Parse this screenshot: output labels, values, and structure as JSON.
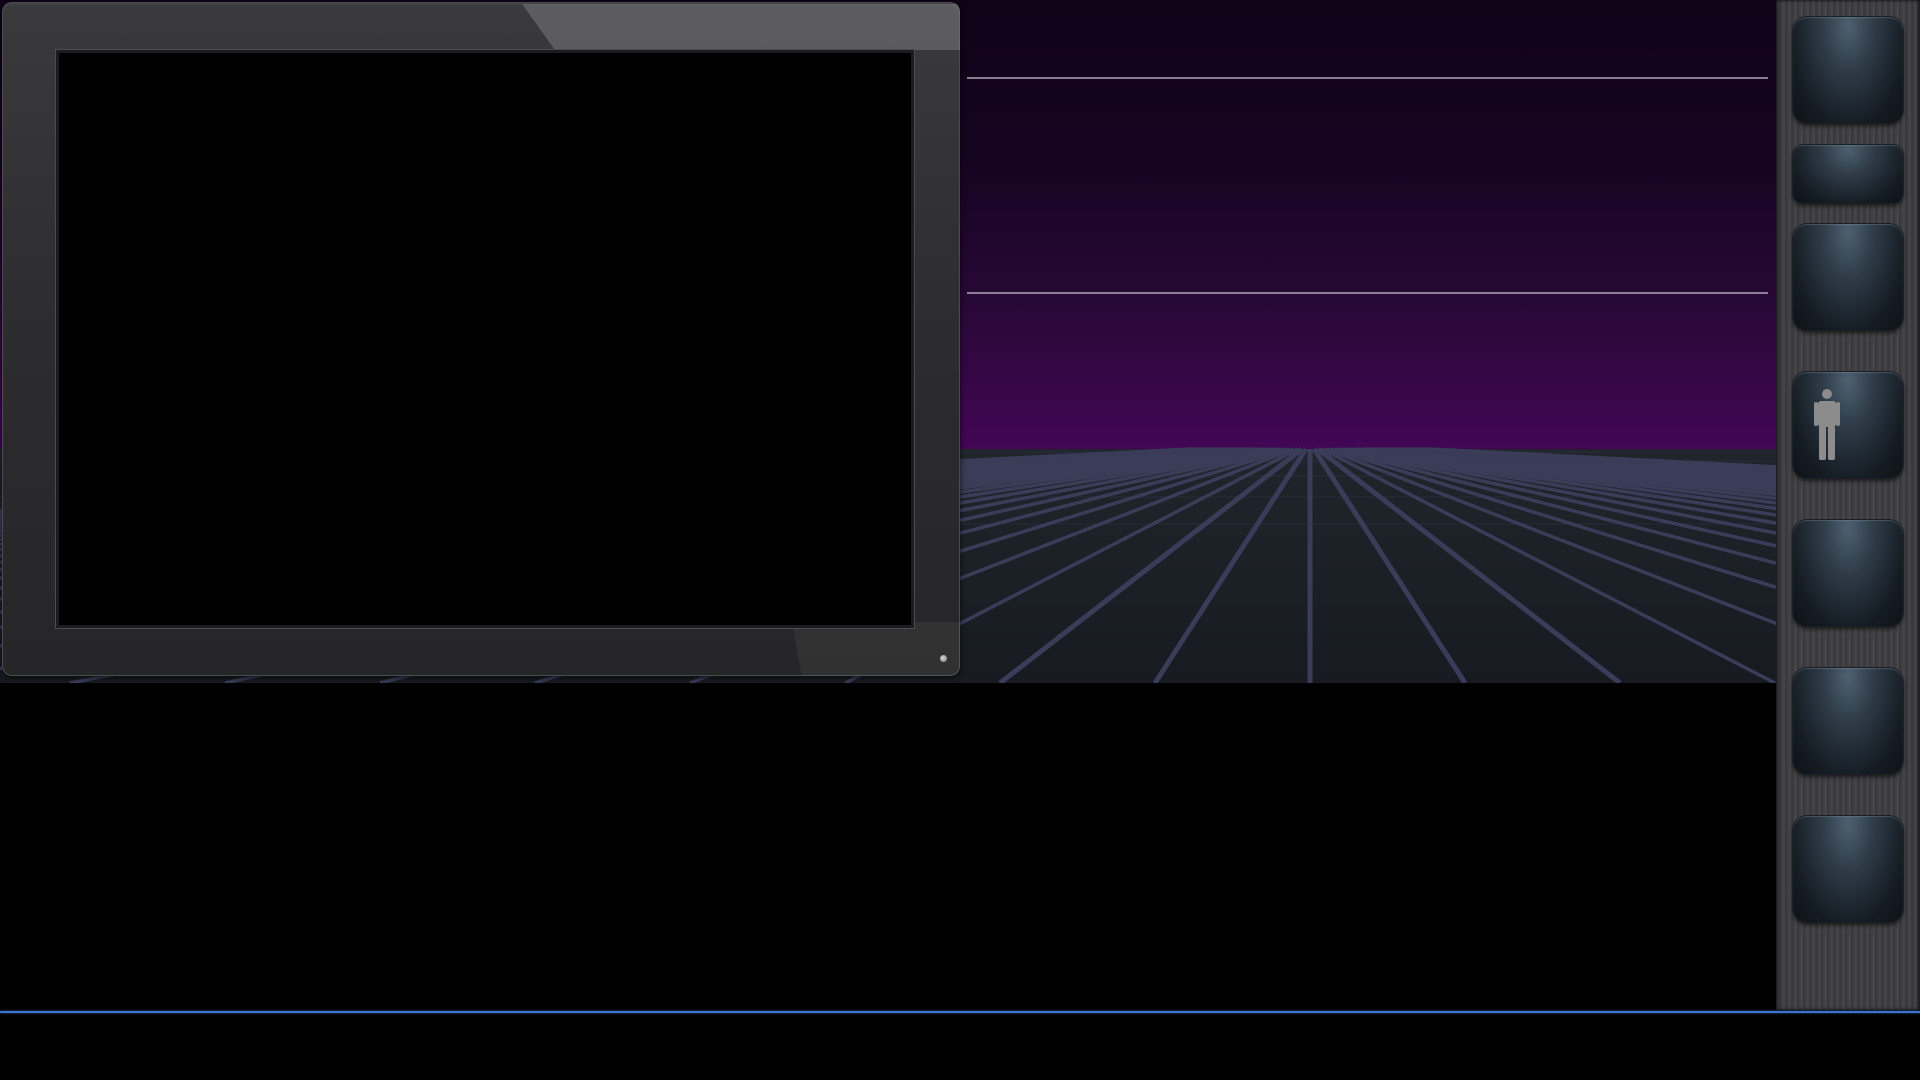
{
  "colors": {
    "sky_top": "#120419",
    "sky_bottom": "#3f0650",
    "floor": "#1b2027",
    "grid_lines": "#3a3c58",
    "horizon_lines": "#c8c8d0",
    "status_line": "#3d74c9"
  },
  "side_strip": {
    "buttons": [
      {
        "id": "slot-1",
        "icon": ""
      },
      {
        "id": "slot-2",
        "icon": ""
      },
      {
        "id": "slot-3",
        "icon": ""
      },
      {
        "id": "slot-4",
        "icon": "person-icon"
      },
      {
        "id": "slot-5",
        "icon": ""
      },
      {
        "id": "slot-6",
        "icon": ""
      },
      {
        "id": "slot-7",
        "icon": ""
      }
    ]
  },
  "monitor": {
    "screen_content": ""
  }
}
